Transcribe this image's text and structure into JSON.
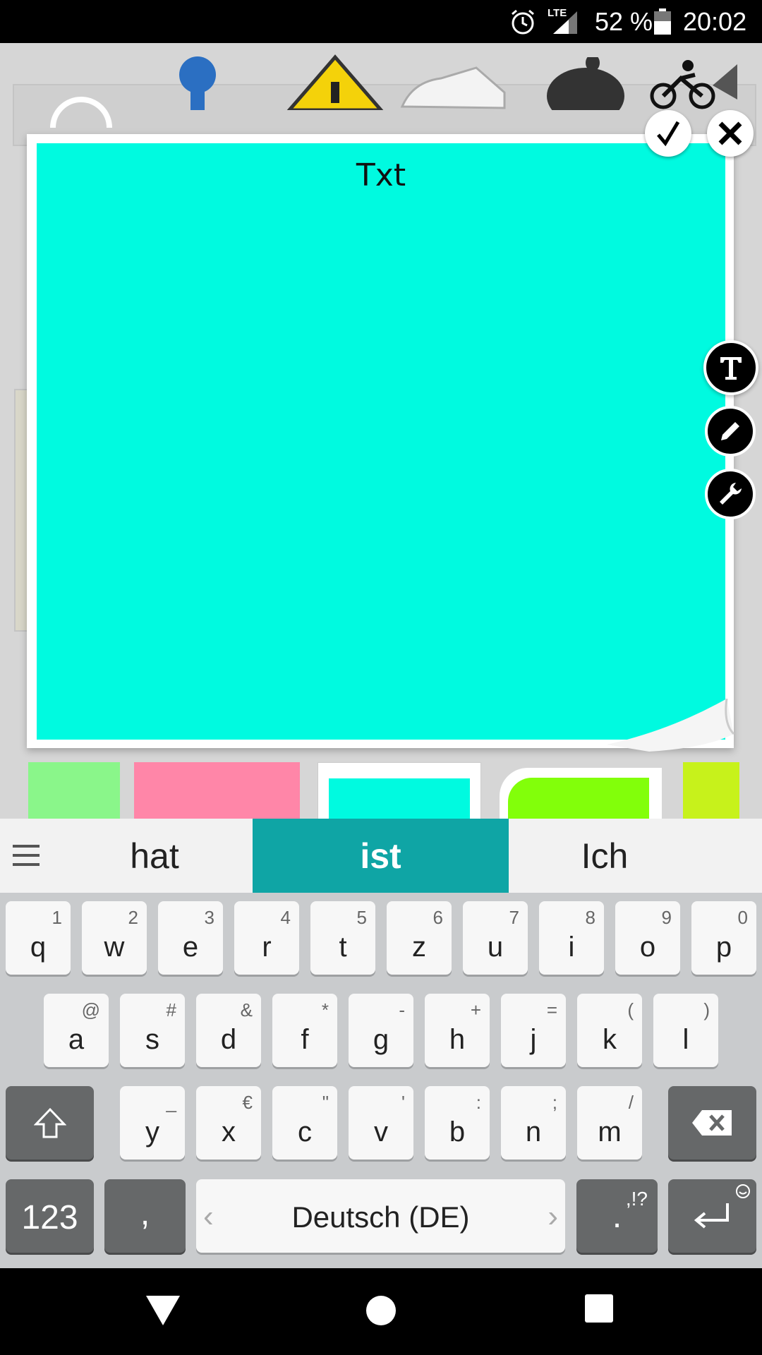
{
  "status_bar": {
    "network": "LTE",
    "battery_percent": "52 %",
    "time": "20:02",
    "icons": [
      "alarm-icon",
      "signal-icon",
      "battery-icon"
    ]
  },
  "note": {
    "title": "Txt",
    "color": "#00fae0"
  },
  "note_actions": {
    "confirm_icon": "checkmark-icon",
    "close_icon": "close-icon"
  },
  "side_tools": [
    "text-tool-icon",
    "pencil-icon",
    "wrench-icon"
  ],
  "swatches": [
    {
      "color": "#7dfc7d"
    },
    {
      "color": "#ff86a8"
    },
    {
      "color": "#00fae0"
    },
    {
      "color": "#82ff0a"
    },
    {
      "color": "#c7f21b"
    }
  ],
  "suggestions": {
    "menu_icon": "menu-icon",
    "words": [
      "hat",
      "ist",
      "Ich"
    ],
    "active_index": 1
  },
  "keyboard": {
    "row1": [
      {
        "key": "q",
        "hint": "1"
      },
      {
        "key": "w",
        "hint": "2"
      },
      {
        "key": "e",
        "hint": "3"
      },
      {
        "key": "r",
        "hint": "4"
      },
      {
        "key": "t",
        "hint": "5"
      },
      {
        "key": "z",
        "hint": "6"
      },
      {
        "key": "u",
        "hint": "7"
      },
      {
        "key": "i",
        "hint": "8"
      },
      {
        "key": "o",
        "hint": "9"
      },
      {
        "key": "p",
        "hint": "0"
      }
    ],
    "row2": [
      {
        "key": "a",
        "hint": "@"
      },
      {
        "key": "s",
        "hint": "#"
      },
      {
        "key": "d",
        "hint": "&"
      },
      {
        "key": "f",
        "hint": "*"
      },
      {
        "key": "g",
        "hint": "-"
      },
      {
        "key": "h",
        "hint": "+"
      },
      {
        "key": "j",
        "hint": "="
      },
      {
        "key": "k",
        "hint": "("
      },
      {
        "key": "l",
        "hint": ")"
      }
    ],
    "row3": [
      {
        "key": "y",
        "hint": "_"
      },
      {
        "key": "x",
        "hint": "€"
      },
      {
        "key": "c",
        "hint": "\""
      },
      {
        "key": "v",
        "hint": "'"
      },
      {
        "key": "b",
        "hint": ":"
      },
      {
        "key": "n",
        "hint": ";"
      },
      {
        "key": "m",
        "hint": "/"
      }
    ],
    "num_key": "123",
    "comma_key": ",",
    "space_label": "Deutsch (DE)",
    "period_key": ".",
    "period_hint": ",!?",
    "shift_icon": "shift-icon",
    "backspace_icon": "backspace-icon",
    "enter_icon": "enter-icon"
  },
  "nav_bar": [
    "back-icon",
    "home-icon",
    "recents-icon"
  ]
}
